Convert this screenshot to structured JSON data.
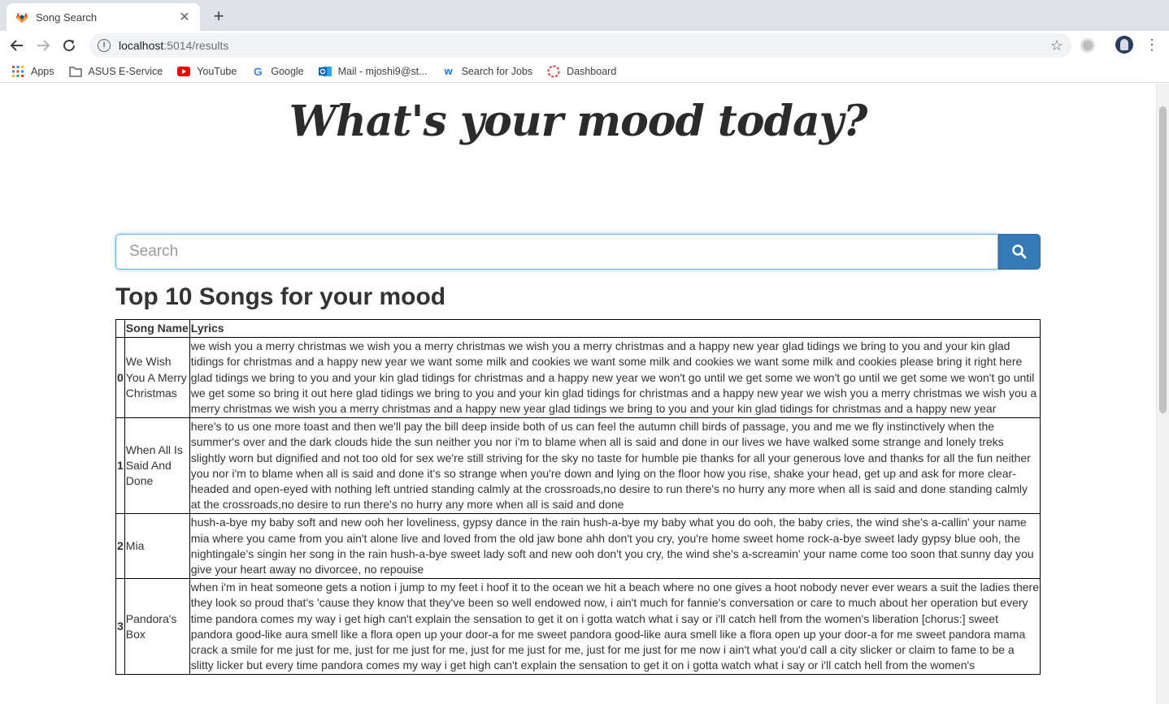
{
  "browser": {
    "tab_title": "Song Search",
    "url_host": "localhost",
    "url_path": ":5014/results",
    "bookmarks": [
      {
        "label": "Apps",
        "icon": "apps-grid-icon"
      },
      {
        "label": "ASUS E-Service",
        "icon": "folder-icon"
      },
      {
        "label": "YouTube",
        "icon": "youtube-icon"
      },
      {
        "label": "Google",
        "icon": "google-icon"
      },
      {
        "label": "Mail - mjoshi9@st...",
        "icon": "outlook-icon"
      },
      {
        "label": "Search for Jobs",
        "icon": "jobs-icon"
      },
      {
        "label": "Dashboard",
        "icon": "dashboard-icon"
      }
    ]
  },
  "page": {
    "heading": "What's your mood today?",
    "search_placeholder": "Search",
    "section_title": "Top 10 Songs for your mood",
    "table": {
      "headers": [
        "",
        "Song Name",
        "Lyrics"
      ],
      "rows": [
        {
          "index": "0",
          "name": "We Wish You A Merry Christmas",
          "lyrics": "we wish you a merry christmas we wish you a merry christmas we wish you a merry christmas and a happy new year glad tidings we bring to you and your kin glad tidings for christmas and a happy new year we want some milk and cookies we want some milk and cookies we want some milk and cookies please bring it right here glad tidings we bring to you and your kin glad tidings for christmas and a happy new year we won't go until we get some we won't go until we get some we won't go until we get some so bring it out here glad tidings we bring to you and your kin glad tidings for christmas and a happy new year we wish you a merry christmas we wish you a merry christmas we wish you a merry christmas and a happy new year glad tidings we bring to you and your kin glad tidings for christmas and a happy new year"
        },
        {
          "index": "1",
          "name": "When All Is Said And Done",
          "lyrics": "here's to us one more toast and then we'll pay the bill deep inside both of us can feel the autumn chill birds of passage, you and me we fly instinctively when the summer's over and the dark clouds hide the sun neither you nor i'm to blame when all is said and done in our lives we have walked some strange and lonely treks slightly worn but dignified and not too old for sex we're still striving for the sky no taste for humble pie thanks for all your generous love and thanks for all the fun neither you nor i'm to blame when all is said and done it's so strange when you're down and lying on the floor how you rise, shake your head, get up and ask for more clear-headed and open-eyed with nothing left untried standing calmly at the crossroads,no desire to run there's no hurry any more when all is said and done standing calmly at the crossroads,no desire to run there's no hurry any more when all is said and done"
        },
        {
          "index": "2",
          "name": "Mia",
          "lyrics": "hush-a-bye my baby soft and new ooh her loveliness, gypsy dance in the rain hush-a-bye my baby what you do ooh, the baby cries, the wind she's a-callin' your name mia where you came from you ain't alone live and loved from the old jaw bone ahh don't you cry, you're home sweet home rock-a-bye sweet lady gypsy blue ooh, the nightingale's singin her song in the rain hush-a-bye sweet lady soft and new ooh don't you cry, the wind she's a-screamin' your name come too soon that sunny day you give your heart away no divorcee, no repouise"
        },
        {
          "index": "3",
          "name": "Pandora's Box",
          "lyrics": "when i'm in heat someone gets a notion i jump to my feet i hoof it to the ocean we hit a beach where no one gives a hoot nobody never ever wears a suit the ladies there they look so proud that's 'cause they know that they've been so well endowed now, i ain't much for fannie's conversation or care to much about her operation but every time pandora comes my way i get high can't explain the sensation to get it on i gotta watch what i say or i'll catch hell from the women's liberation [chorus:] sweet pandora good-like aura smell like a flora open up your door-a for me sweet pandora good-like aura smell like a flora open up your door-a for me sweet pandora mama crack a smile for me just for me, just for me just for me, just for me just for me, just for me just for me now i ain't what you'd call a city slicker or claim to fame to be a slitty licker but every time pandora comes my way i get high can't explain the sensation to get it on i gotta watch what i say or i'll catch hell from the women's"
        }
      ]
    }
  }
}
